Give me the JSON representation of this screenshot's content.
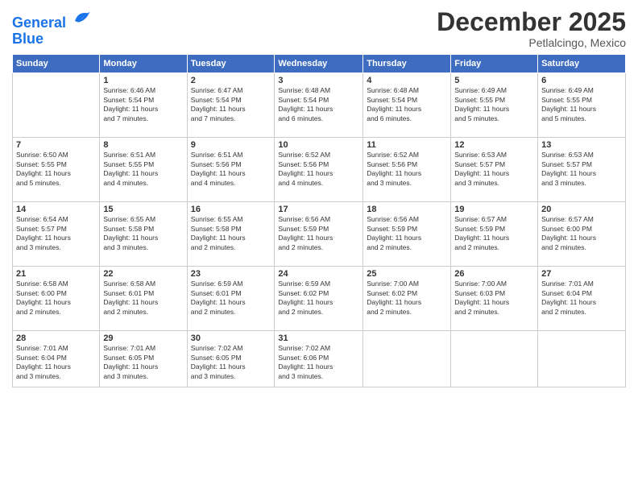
{
  "header": {
    "logo_line1": "General",
    "logo_line2": "Blue",
    "month": "December 2025",
    "location": "Petlalcingo, Mexico"
  },
  "weekdays": [
    "Sunday",
    "Monday",
    "Tuesday",
    "Wednesday",
    "Thursday",
    "Friday",
    "Saturday"
  ],
  "weeks": [
    [
      {
        "day": "",
        "info": ""
      },
      {
        "day": "1",
        "info": "Sunrise: 6:46 AM\nSunset: 5:54 PM\nDaylight: 11 hours\nand 7 minutes."
      },
      {
        "day": "2",
        "info": "Sunrise: 6:47 AM\nSunset: 5:54 PM\nDaylight: 11 hours\nand 7 minutes."
      },
      {
        "day": "3",
        "info": "Sunrise: 6:48 AM\nSunset: 5:54 PM\nDaylight: 11 hours\nand 6 minutes."
      },
      {
        "day": "4",
        "info": "Sunrise: 6:48 AM\nSunset: 5:54 PM\nDaylight: 11 hours\nand 6 minutes."
      },
      {
        "day": "5",
        "info": "Sunrise: 6:49 AM\nSunset: 5:55 PM\nDaylight: 11 hours\nand 5 minutes."
      },
      {
        "day": "6",
        "info": "Sunrise: 6:49 AM\nSunset: 5:55 PM\nDaylight: 11 hours\nand 5 minutes."
      }
    ],
    [
      {
        "day": "7",
        "info": "Sunrise: 6:50 AM\nSunset: 5:55 PM\nDaylight: 11 hours\nand 5 minutes."
      },
      {
        "day": "8",
        "info": "Sunrise: 6:51 AM\nSunset: 5:55 PM\nDaylight: 11 hours\nand 4 minutes."
      },
      {
        "day": "9",
        "info": "Sunrise: 6:51 AM\nSunset: 5:56 PM\nDaylight: 11 hours\nand 4 minutes."
      },
      {
        "day": "10",
        "info": "Sunrise: 6:52 AM\nSunset: 5:56 PM\nDaylight: 11 hours\nand 4 minutes."
      },
      {
        "day": "11",
        "info": "Sunrise: 6:52 AM\nSunset: 5:56 PM\nDaylight: 11 hours\nand 3 minutes."
      },
      {
        "day": "12",
        "info": "Sunrise: 6:53 AM\nSunset: 5:57 PM\nDaylight: 11 hours\nand 3 minutes."
      },
      {
        "day": "13",
        "info": "Sunrise: 6:53 AM\nSunset: 5:57 PM\nDaylight: 11 hours\nand 3 minutes."
      }
    ],
    [
      {
        "day": "14",
        "info": "Sunrise: 6:54 AM\nSunset: 5:57 PM\nDaylight: 11 hours\nand 3 minutes."
      },
      {
        "day": "15",
        "info": "Sunrise: 6:55 AM\nSunset: 5:58 PM\nDaylight: 11 hours\nand 3 minutes."
      },
      {
        "day": "16",
        "info": "Sunrise: 6:55 AM\nSunset: 5:58 PM\nDaylight: 11 hours\nand 2 minutes."
      },
      {
        "day": "17",
        "info": "Sunrise: 6:56 AM\nSunset: 5:59 PM\nDaylight: 11 hours\nand 2 minutes."
      },
      {
        "day": "18",
        "info": "Sunrise: 6:56 AM\nSunset: 5:59 PM\nDaylight: 11 hours\nand 2 minutes."
      },
      {
        "day": "19",
        "info": "Sunrise: 6:57 AM\nSunset: 5:59 PM\nDaylight: 11 hours\nand 2 minutes."
      },
      {
        "day": "20",
        "info": "Sunrise: 6:57 AM\nSunset: 6:00 PM\nDaylight: 11 hours\nand 2 minutes."
      }
    ],
    [
      {
        "day": "21",
        "info": "Sunrise: 6:58 AM\nSunset: 6:00 PM\nDaylight: 11 hours\nand 2 minutes."
      },
      {
        "day": "22",
        "info": "Sunrise: 6:58 AM\nSunset: 6:01 PM\nDaylight: 11 hours\nand 2 minutes."
      },
      {
        "day": "23",
        "info": "Sunrise: 6:59 AM\nSunset: 6:01 PM\nDaylight: 11 hours\nand 2 minutes."
      },
      {
        "day": "24",
        "info": "Sunrise: 6:59 AM\nSunset: 6:02 PM\nDaylight: 11 hours\nand 2 minutes."
      },
      {
        "day": "25",
        "info": "Sunrise: 7:00 AM\nSunset: 6:02 PM\nDaylight: 11 hours\nand 2 minutes."
      },
      {
        "day": "26",
        "info": "Sunrise: 7:00 AM\nSunset: 6:03 PM\nDaylight: 11 hours\nand 2 minutes."
      },
      {
        "day": "27",
        "info": "Sunrise: 7:01 AM\nSunset: 6:04 PM\nDaylight: 11 hours\nand 2 minutes."
      }
    ],
    [
      {
        "day": "28",
        "info": "Sunrise: 7:01 AM\nSunset: 6:04 PM\nDaylight: 11 hours\nand 3 minutes."
      },
      {
        "day": "29",
        "info": "Sunrise: 7:01 AM\nSunset: 6:05 PM\nDaylight: 11 hours\nand 3 minutes."
      },
      {
        "day": "30",
        "info": "Sunrise: 7:02 AM\nSunset: 6:05 PM\nDaylight: 11 hours\nand 3 minutes."
      },
      {
        "day": "31",
        "info": "Sunrise: 7:02 AM\nSunset: 6:06 PM\nDaylight: 11 hours\nand 3 minutes."
      },
      {
        "day": "",
        "info": ""
      },
      {
        "day": "",
        "info": ""
      },
      {
        "day": "",
        "info": ""
      }
    ]
  ]
}
